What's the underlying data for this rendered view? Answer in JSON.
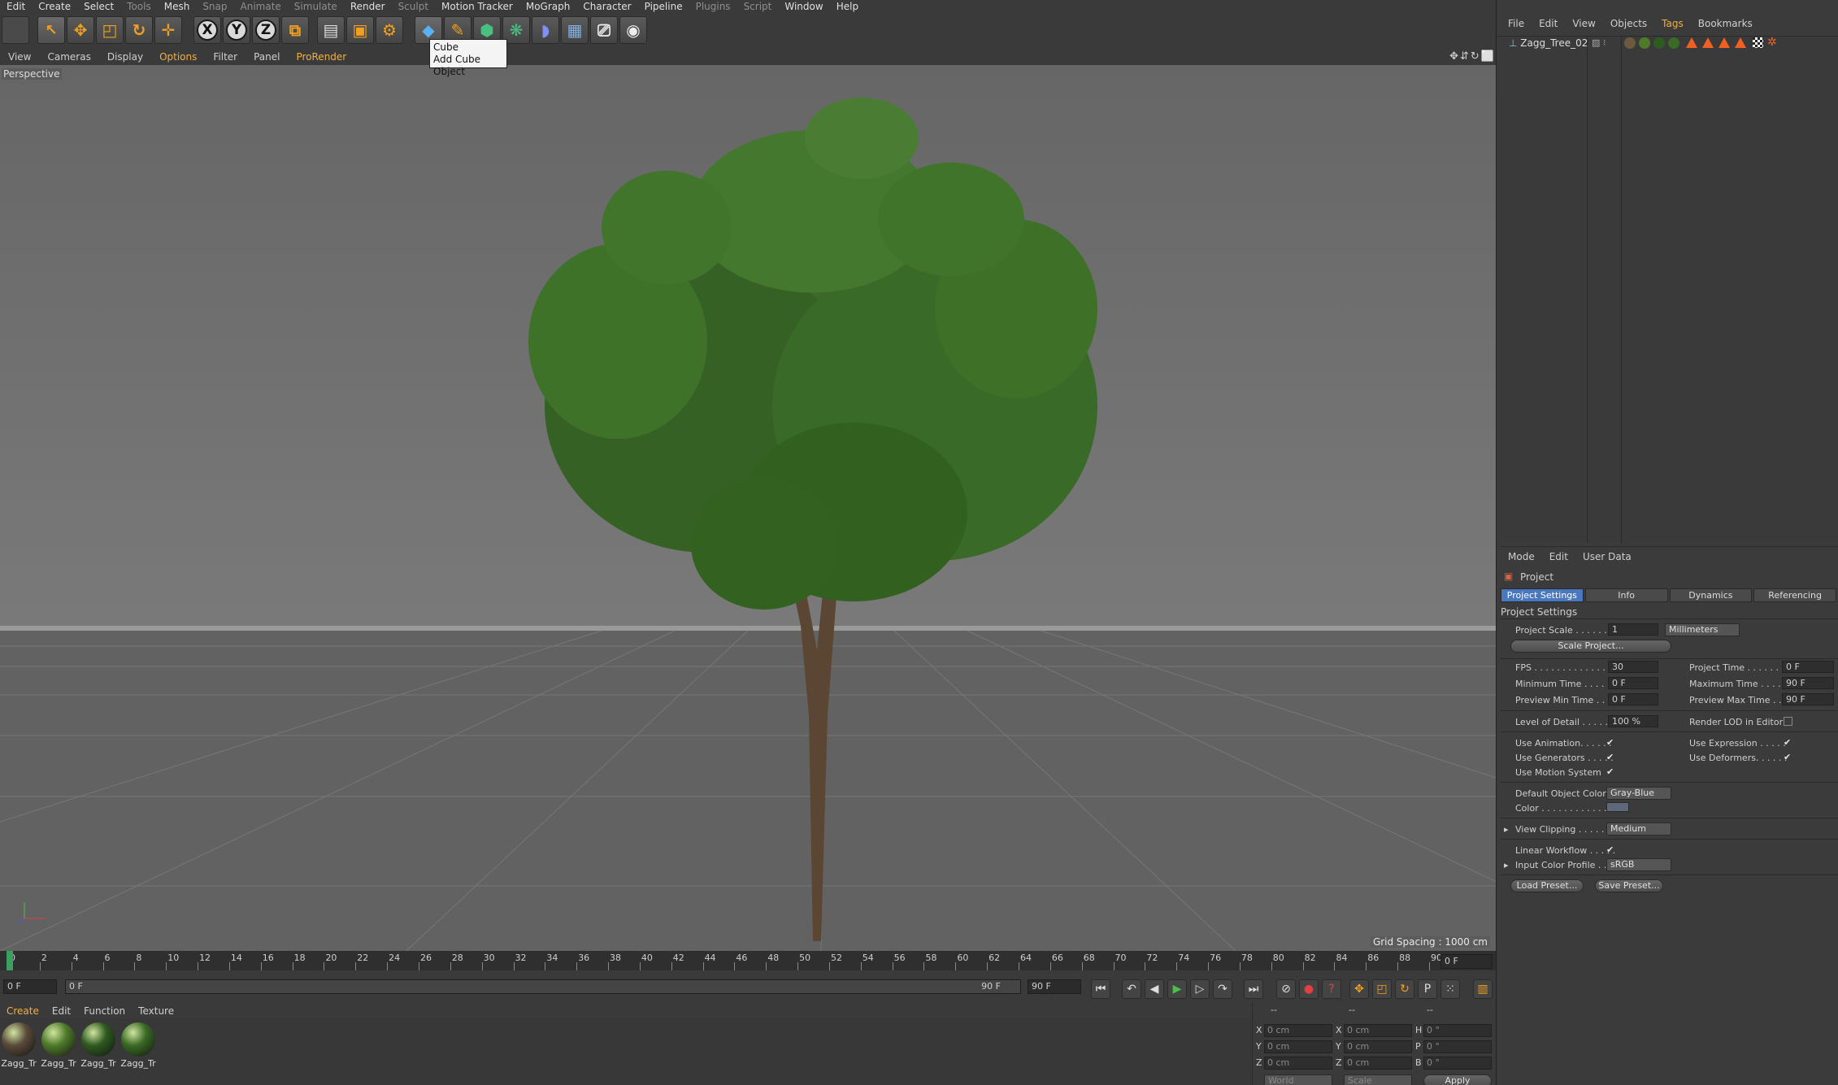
{
  "menubar": [
    "Edit",
    "Create",
    "Select",
    "Tools",
    "Mesh",
    "Snap",
    "Animate",
    "Simulate",
    "Render",
    "Sculpt",
    "Motion Tracker",
    "MoGraph",
    "Character",
    "Pipeline",
    "Plugins",
    "Script",
    "Window",
    "Help"
  ],
  "tooltip": {
    "title": "Cube",
    "desc": "Add Cube Object"
  },
  "viewport_menu": [
    "View",
    "Cameras",
    "Display",
    "Options",
    "Filter",
    "Panel",
    "ProRender"
  ],
  "viewport": {
    "label": "Perspective",
    "grid_spacing": "Grid Spacing : 1000 cm"
  },
  "timeline": {
    "ticks": [
      "0",
      "2",
      "4",
      "6",
      "8",
      "10",
      "12",
      "14",
      "16",
      "18",
      "20",
      "22",
      "24",
      "26",
      "28",
      "30",
      "32",
      "34",
      "36",
      "38",
      "40",
      "42",
      "44",
      "46",
      "48",
      "50",
      "52",
      "54",
      "56",
      "58",
      "60",
      "62",
      "64",
      "66",
      "68",
      "70",
      "72",
      "74",
      "76",
      "78",
      "80",
      "82",
      "84",
      "86",
      "88",
      "90"
    ],
    "current_frame": "0 F",
    "start": "0 F",
    "range_start": "0 F",
    "range_end": "90 F",
    "end": "90 F"
  },
  "material_menu": [
    "Create",
    "Edit",
    "Function",
    "Texture"
  ],
  "materials": [
    {
      "label": "Zagg_Tr",
      "color": "#5a4a3a"
    },
    {
      "label": "Zagg_Tr",
      "color": "#4f7a2a"
    },
    {
      "label": "Zagg_Tr",
      "color": "#2f5a20"
    },
    {
      "label": "Zagg_Tr",
      "color": "#3a6a25"
    }
  ],
  "coords": {
    "pos_label": "--",
    "size_label": "--",
    "rot_label": "--",
    "x": "0 cm",
    "y": "0 cm",
    "z": "0 cm",
    "sx": "0 cm",
    "sy": "0 cm",
    "sz": "0 cm",
    "h": "0 °",
    "p": "0 °",
    "b": "0 °",
    "mode": "World",
    "scale": "Scale",
    "apply": "Apply"
  },
  "object_menu": [
    "File",
    "Edit",
    "View",
    "Objects",
    "Tags",
    "Bookmarks"
  ],
  "object": {
    "name": "Zagg_Tree_02"
  },
  "attr_menu": [
    "Mode",
    "Edit",
    "User Data"
  ],
  "attr": {
    "title": "Project",
    "tabs": [
      "Project Settings",
      "Info",
      "Dynamics",
      "Referencing"
    ],
    "section": "Project Settings",
    "project_scale_label": "Project Scale . . . . . .",
    "project_scale": "1",
    "units": "Millimeters",
    "scale_project": "Scale Project...",
    "fps_label": "FPS . . . . . . . . . . . . . . . .",
    "fps": "30",
    "project_time_label": "Project Time . . . . . . . .",
    "project_time": "0 F",
    "min_time_label": "Minimum Time . . . . . .",
    "min_time": "0 F",
    "max_time_label": "Maximum Time . . . . .",
    "max_time": "90 F",
    "prev_min_label": "Preview Min Time . .",
    "prev_min": "0 F",
    "prev_max_label": "Preview Max Time . .",
    "prev_max": "90 F",
    "lod_label": "Level of Detail . . . . . .",
    "lod": "100 %",
    "render_lod_label": "Render LOD in Editor",
    "use_anim_label": "Use Animation. . . . . .",
    "use_expr_label": "Use Expression . . . . .",
    "use_gen_label": "Use Generators . . . . .",
    "use_def_label": "Use Deformers. . . . . .",
    "use_motion_label": "Use Motion System",
    "default_color_label": "Default Object Color",
    "default_color": "Gray-Blue",
    "color_label": "Color . . . . . . . . . . . .",
    "view_clip_label": "View Clipping . . . . . .",
    "view_clip": "Medium",
    "linear_label": "Linear Workflow . . . . .",
    "input_profile_label": "Input Color Profile . .",
    "input_profile": "sRGB",
    "load_preset": "Load Preset...",
    "save_preset": "Save Preset...",
    "check": "✔"
  }
}
